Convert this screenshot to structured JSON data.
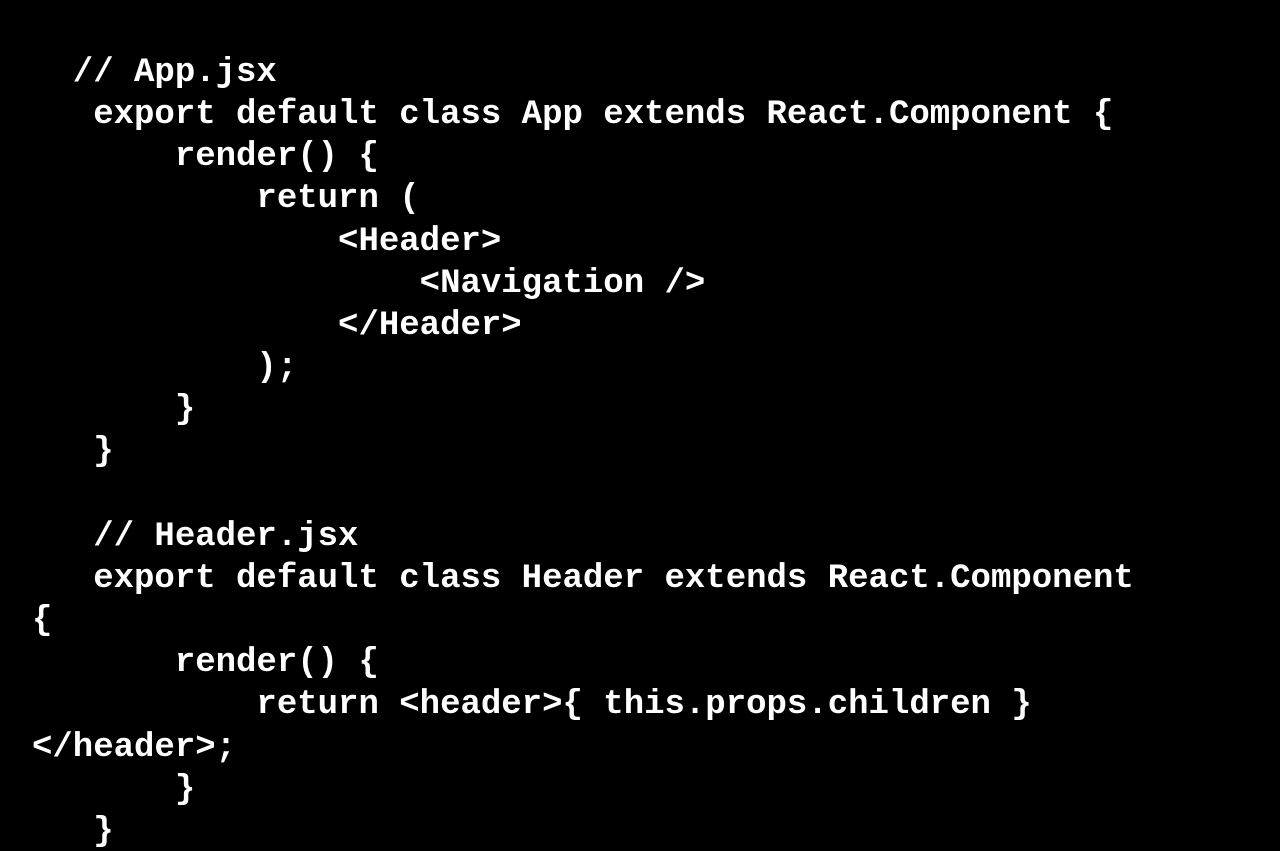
{
  "code": {
    "lines": [
      "  // App.jsx",
      "   export default class App extends React.Component {",
      "       render() {",
      "           return (",
      "               <Header>",
      "                   <Navigation />",
      "               </Header>",
      "           );",
      "       }",
      "   }",
      "",
      "   // Header.jsx",
      "   export default class Header extends React.Component",
      "{",
      "       render() {",
      "           return <header>{ this.props.children }",
      "</header>;",
      "       }",
      "   }"
    ]
  }
}
